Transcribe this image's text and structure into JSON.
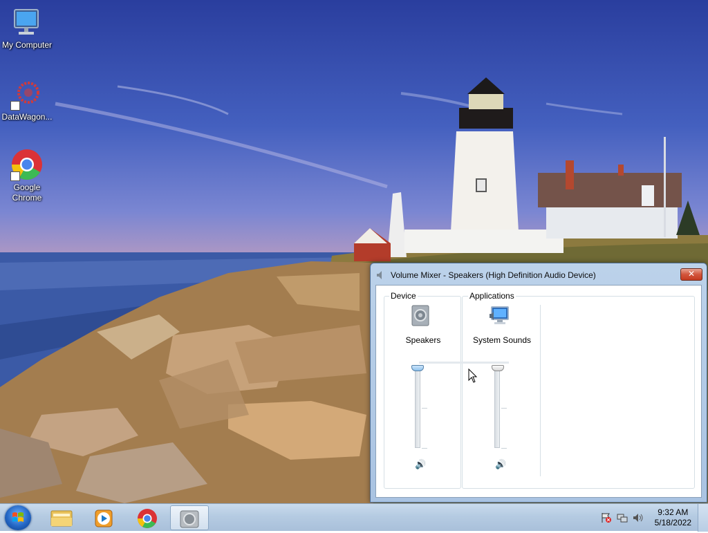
{
  "desktop": {
    "icons": [
      {
        "label": "My Computer",
        "icon": "computer-icon"
      },
      {
        "label": "DataWagon...",
        "icon": "datawagon-icon"
      },
      {
        "label": "Google Chrome",
        "icon": "chrome-icon"
      }
    ]
  },
  "volume_mixer": {
    "title": "Volume Mixer - Speakers (High Definition Audio Device)",
    "close_label": "✕",
    "device_group": "Device",
    "applications_group": "Applications",
    "channels": [
      {
        "label": "Speakers",
        "icon": "speaker-device-icon",
        "level": 1.0,
        "muted": false
      },
      {
        "label": "System Sounds",
        "icon": "system-sounds-icon",
        "level": 1.0,
        "muted": false
      }
    ],
    "mute_glyph": "🔊"
  },
  "taskbar": {
    "pinned": [
      {
        "name": "windows-explorer",
        "icon": "folder-icon"
      },
      {
        "name": "windows-media-player",
        "icon": "media-player-icon"
      },
      {
        "name": "google-chrome",
        "icon": "chrome-icon"
      },
      {
        "name": "volume-mixer",
        "icon": "speaker-icon",
        "active": true
      }
    ],
    "clock": {
      "time": "9:32 AM",
      "date": "5/18/2022"
    }
  },
  "colors": {
    "accent": "#2467c5",
    "taskbar": "#b5cbe2",
    "window_frame": "#a9c3e2"
  }
}
